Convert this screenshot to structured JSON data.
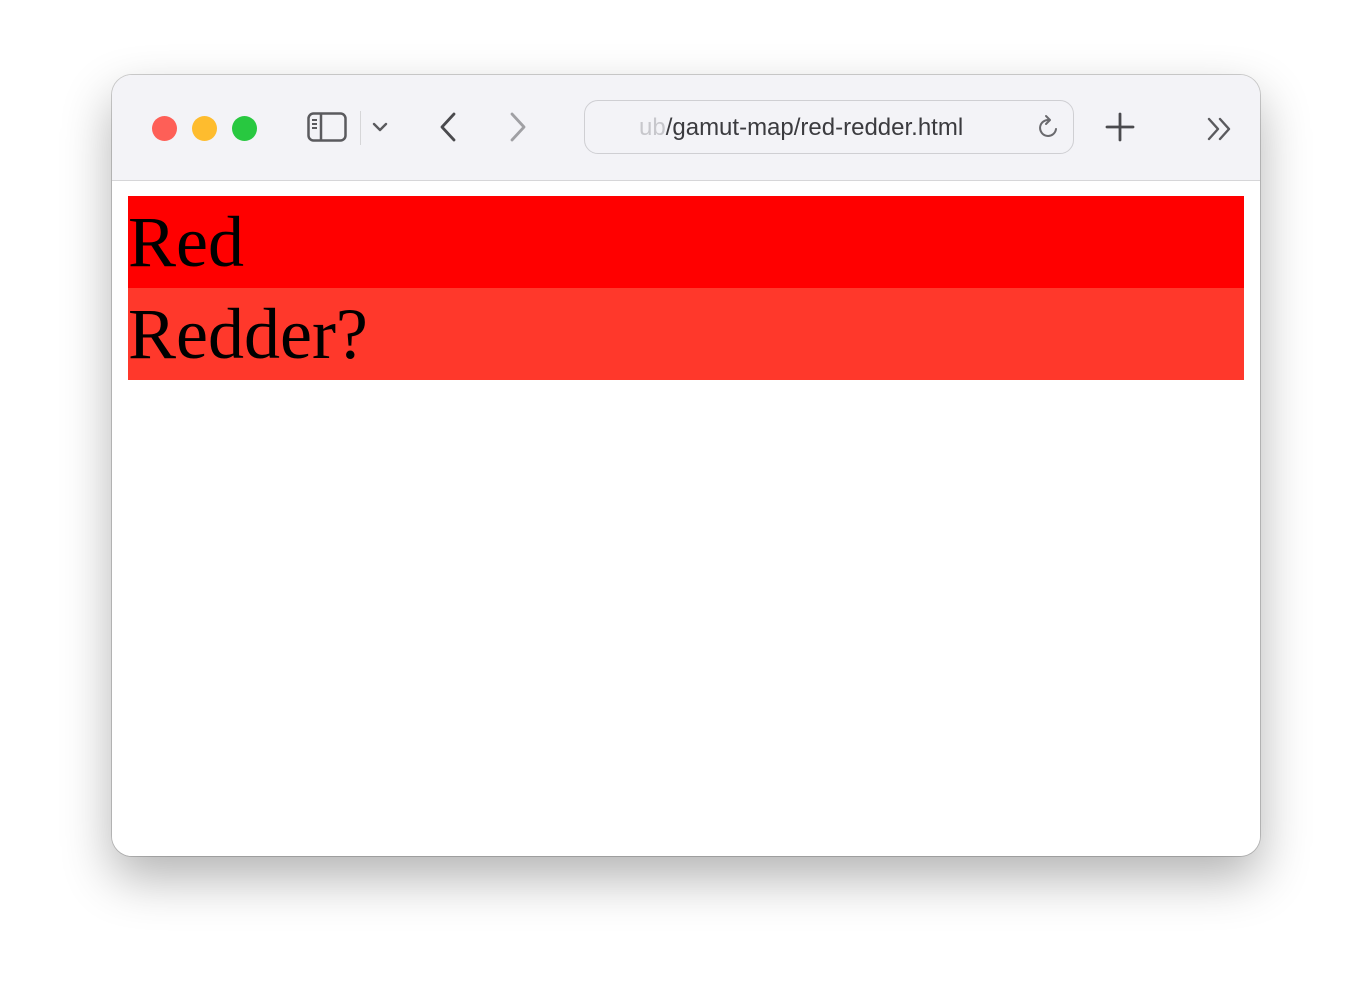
{
  "browser": {
    "url_prefix_faded": "ub",
    "url_main": "/gamut-map/red-redder.html",
    "icons": {
      "close": "close-traffic-light",
      "minimize": "minimize-traffic-light",
      "zoom": "zoom-traffic-light",
      "sidebar": "sidebar-icon",
      "sidebar_menu": "chevron-down-icon",
      "back": "chevron-left-icon",
      "forward": "chevron-right-icon",
      "reload": "reload-icon",
      "new_tab": "plus-icon",
      "more": "double-chevron-right-icon"
    },
    "colors": {
      "close": "#fe5f57",
      "minimize": "#febc2e",
      "zoom": "#28c840"
    }
  },
  "page": {
    "rows": [
      {
        "label": "Red",
        "color": "#ff0000"
      },
      {
        "label": "Redder?",
        "color": "#ff382b"
      }
    ]
  }
}
